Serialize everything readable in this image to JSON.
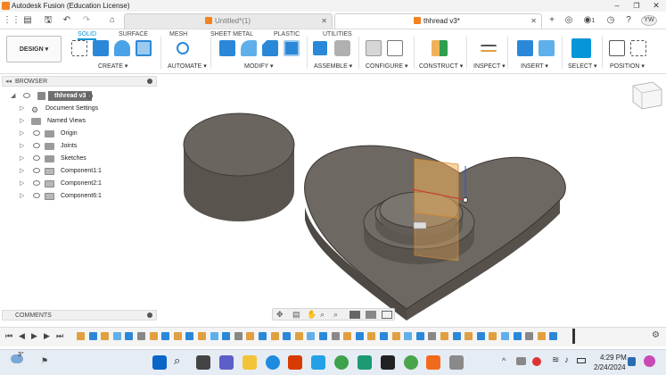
{
  "window": {
    "title": "Autodesk Fusion (Education License)",
    "minimize": "–",
    "maximize": "❐",
    "close": "✕"
  },
  "tabs": [
    {
      "label": "Untitled*(1)",
      "close": "✕"
    },
    {
      "label": "thhread v3*",
      "close": "✕"
    }
  ],
  "qat": {
    "notifications": "1",
    "user_initials": "YW"
  },
  "workspace": {
    "label": "DESIGN ▾"
  },
  "ribbon_tabs": [
    "SOLID",
    "SURFACE",
    "MESH",
    "SHEET METAL",
    "PLASTIC",
    "UTILITIES"
  ],
  "ribbon_groups": [
    "CREATE ▾",
    "AUTOMATE ▾",
    "MODIFY ▾",
    "ASSEMBLE ▾",
    "CONFIGURE ▾",
    "CONSTRUCT ▾",
    "INSPECT ▾",
    "INSERT ▾",
    "SELECT ▾",
    "POSITION ▾"
  ],
  "browser": {
    "header": "BROWSER",
    "root": "thhread v3",
    "items": [
      "Document Settings",
      "Named Views",
      "Origin",
      "Joints",
      "Sketches",
      "Component1:1",
      "Component2:1",
      "Component6:1"
    ]
  },
  "comments": {
    "label": "COMMENTS"
  },
  "taskbar": {
    "weather": "3°",
    "time": "4:29 PM",
    "date": "2/24/2024"
  },
  "colors": {
    "accent": "#0696d7",
    "fusion_orange": "#f58220",
    "model_dark": "#5e5852",
    "model_top": "#6e6862",
    "plane": "#f2b05a"
  }
}
